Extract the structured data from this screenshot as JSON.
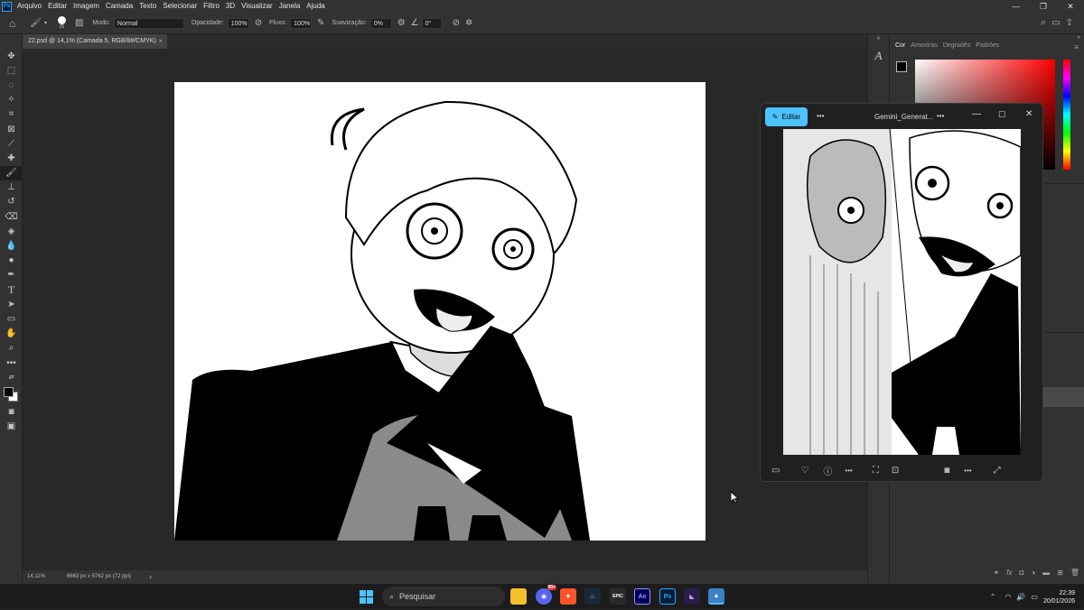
{
  "app": {
    "logo_text": "Ps"
  },
  "menubar": {
    "items": [
      "Arquivo",
      "Editar",
      "Imagem",
      "Camada",
      "Texto",
      "Selecionar",
      "Filtro",
      "3D",
      "Visualizar",
      "Janela",
      "Ajuda"
    ]
  },
  "options_bar": {
    "brush_size": "25",
    "mode_label": "Modo:",
    "mode_value": "Normal",
    "opacity_label": "Opacidade:",
    "opacity_value": "100%",
    "flow_label": "Fluxo:",
    "flow_value": "100%",
    "smoothing_label": "Suavização:",
    "smoothing_value": "0%",
    "angle_value": "0°"
  },
  "document": {
    "tab_title": "22.psd @ 14,1% (Camada 5, RGB/8#/CMYK)",
    "close_glyph": "×"
  },
  "status": {
    "zoom": "14,11%",
    "dimensions": "6663 px x 5762 px (72 ppi)",
    "arrow": "›"
  },
  "panels": {
    "tabs": [
      "Cor",
      "Amostras",
      "Degradês",
      "Padrões"
    ]
  },
  "photos_window": {
    "edit_label": "Editar",
    "filename": "Gemini_Generat...",
    "more": "•••"
  },
  "taskbar": {
    "search_placeholder": "Pesquisar",
    "time": "22:39",
    "date": "20/01/2026",
    "discord_badge": "99+"
  },
  "colors": {
    "accent": "#4cc2ff",
    "ps_blue": "#31a8ff",
    "panel": "#323232",
    "canvas_bg": "#282828"
  }
}
